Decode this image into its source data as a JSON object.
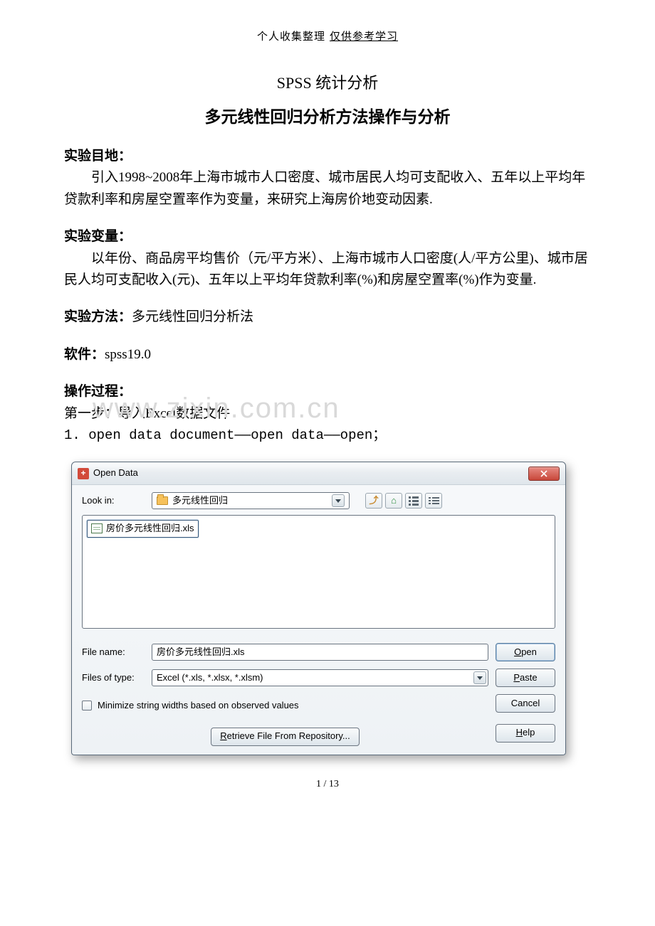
{
  "header": {
    "left": "个人收集整理",
    "right": "仅供参考学习"
  },
  "titles": {
    "t1": "SPSS 统计分析",
    "t2": "多元线性回归分析方法操作与分析"
  },
  "sections": {
    "purpose_label": "实验目地：",
    "purpose_text": "引入1998~2008年上海市城市人口密度、城市居民人均可支配收入、五年以上平均年贷款利率和房屋空置率作为变量，来研究上海房价地变动因素.",
    "vars_label": "实验变量：",
    "vars_text": "以年份、商品房平均售价（元/平方米）、上海市城市人口密度(人/平方公里)、城市居民人均可支配收入(元)、五年以上平均年贷款利率(%)和房屋空置率(%)作为变量.",
    "method_label": "实验方法：",
    "method_text": "多元线性回归分析法",
    "software_label": "软件：",
    "software_text": "spss19.0",
    "process_label": "操作过程：",
    "step1": "第一步：导入Excel数据文件",
    "step1_sub": "1. open data document——open data——open；"
  },
  "watermark": "www.zixin.com.cn",
  "dialog": {
    "title": "Open Data",
    "lookin_label": "Look in:",
    "lookin_value": "多元线性回归",
    "file_item": "房价多元线性回归.xls",
    "filename_label": "File name:",
    "filename_value": "房价多元线性回归.xls",
    "filetype_label": "Files of type:",
    "filetype_value": "Excel (*.xls, *.xlsx, *.xlsm)",
    "minimize_label": "Minimize string widths based on observed values",
    "repo_btn": "Retrieve File From Repository...",
    "buttons": {
      "open": "Open",
      "paste": "Paste",
      "cancel": "Cancel",
      "help": "Help"
    }
  },
  "pagenum": "1 / 13"
}
